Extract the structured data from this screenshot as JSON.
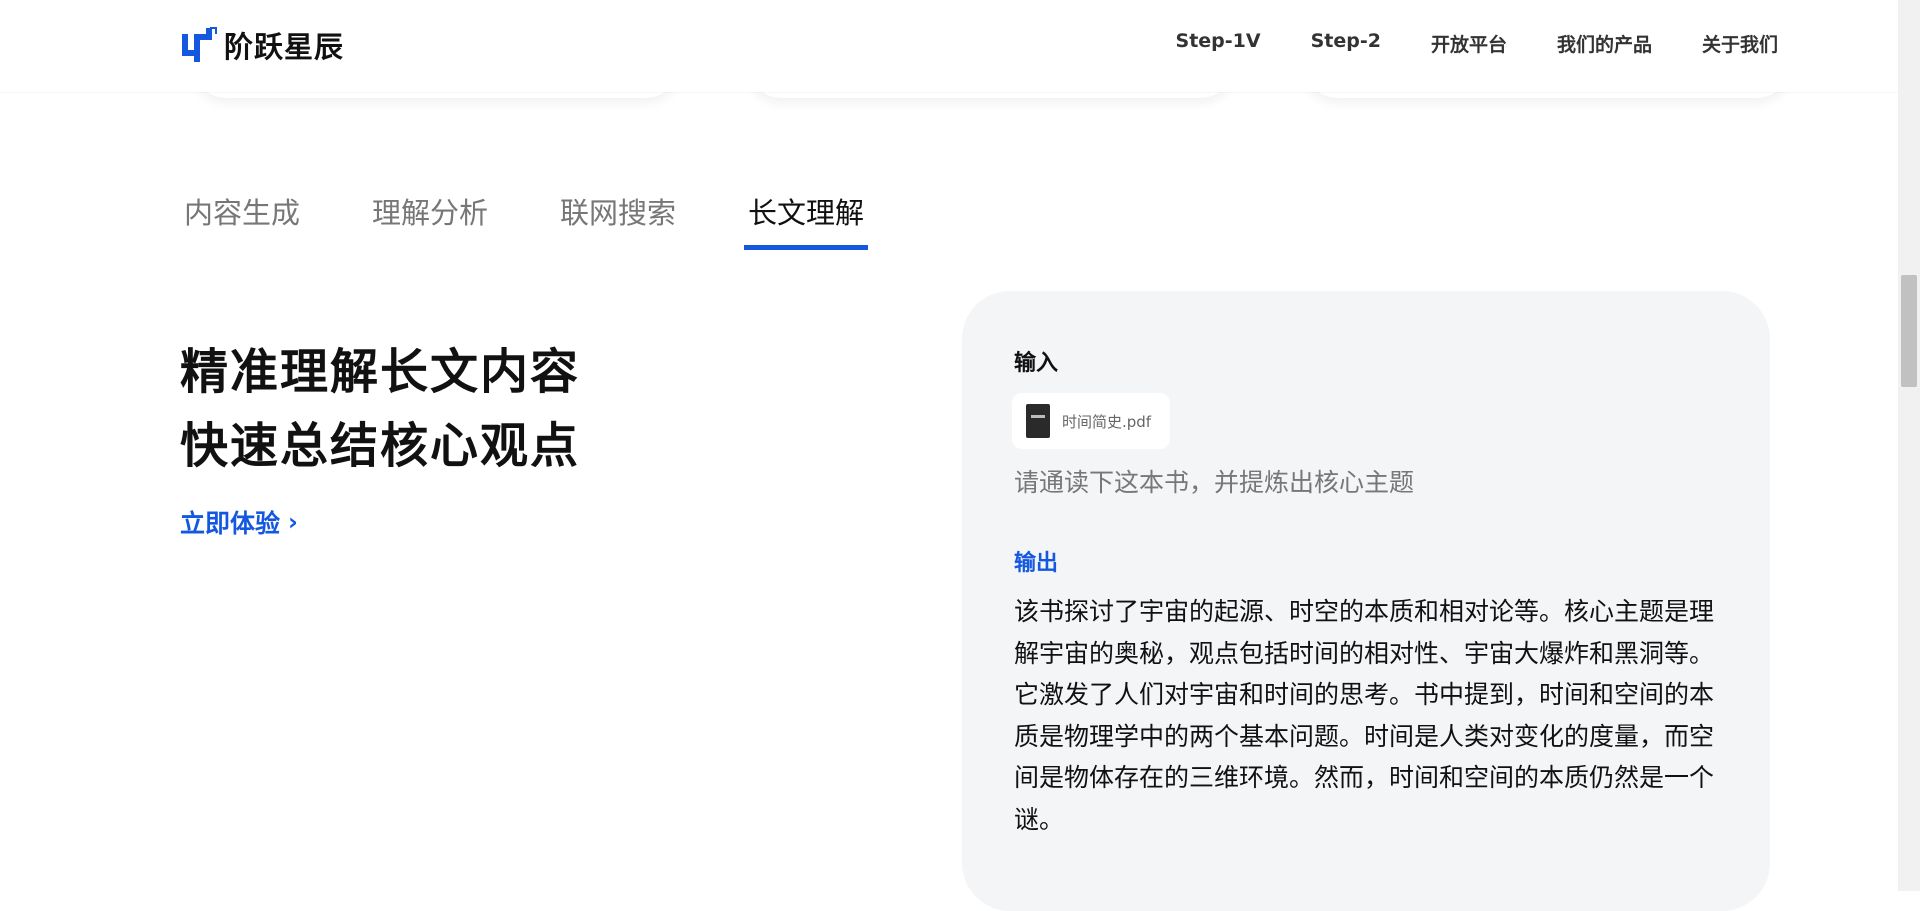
{
  "brand": {
    "name": "阶跃星辰",
    "accent": "#1558e0"
  },
  "nav": {
    "items": [
      "Step-1V",
      "Step-2",
      "开放平台",
      "我们的产品",
      "关于我们"
    ]
  },
  "tabs": [
    {
      "label": "内容生成",
      "active": false
    },
    {
      "label": "理解分析",
      "active": false
    },
    {
      "label": "联网搜索",
      "active": false
    },
    {
      "label": "长文理解",
      "active": true
    }
  ],
  "feature": {
    "headline_line1": "精准理解长文内容",
    "headline_line2": "快速总结核心观点",
    "cta_label": "立即体验"
  },
  "demo": {
    "input_label": "输入",
    "file_name": "时间简史.pdf",
    "prompt": "请通读下这本书，并提炼出核心主题",
    "output_label": "输出",
    "output_text": "该书探讨了宇宙的起源、时空的本质和相对论等。核心主题是理解宇宙的奥秘，观点包括时间的相对性、宇宙大爆炸和黑洞等。它激发了人们对宇宙和时间的思考。书中提到，时间和空间的本质是物理学中的两个基本问题。时间是人类对变化的度量，而空间是物体存在的三维环境。然而，时间和空间的本质仍然是一个谜。"
  }
}
